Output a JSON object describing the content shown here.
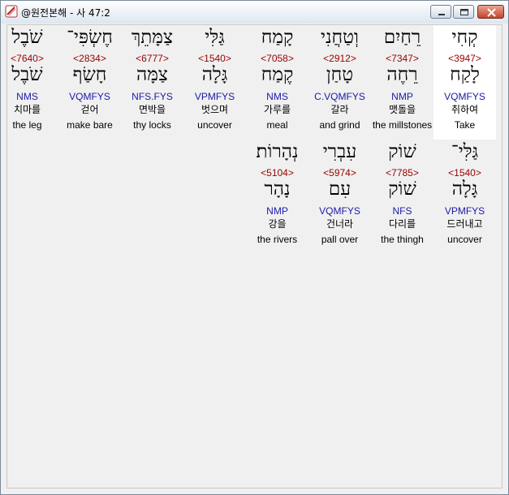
{
  "window": {
    "title": "@원전본해 - 사 47:2",
    "controls": [
      "minimize-icon",
      "maximize-icon",
      "close-icon"
    ]
  },
  "rows": [
    {
      "words": [
        {
          "heb": "קְחִי",
          "strong": "<3947>",
          "lemma": "לָקַח",
          "morph": "VQMFYS",
          "kor": "취하여",
          "eng": "Take",
          "highlighted": true
        },
        {
          "heb": "רֵחַיִם",
          "strong": "<7347>",
          "lemma": "רֵחֶה",
          "morph": "NMP",
          "kor": "맷돌을",
          "eng": "the millstones",
          "highlighted": false
        },
        {
          "heb": "וְטַחֲנִי",
          "strong": "<2912>",
          "lemma": "טָחַן",
          "morph": "C.VQMFYS",
          "kor": "갈라",
          "eng": "and grind",
          "highlighted": false
        },
        {
          "heb": "קָמַח",
          "strong": "<7058>",
          "lemma": "קֶמַח",
          "morph": "NMS",
          "kor": "가루를",
          "eng": "meal",
          "highlighted": false
        },
        {
          "heb": "גַּלִּי",
          "strong": "<1540>",
          "lemma": "גָּלָה",
          "morph": "VPMFYS",
          "kor": "벗으며",
          "eng": "uncover",
          "highlighted": false
        },
        {
          "heb": "צַמָּתֵךְ",
          "strong": "<6777>",
          "lemma": "צַמָּה",
          "morph": "NFS.FYS",
          "kor": "면박을",
          "eng": "thy locks",
          "highlighted": false
        },
        {
          "heb": "חֶשְׂפִּי־",
          "strong": "<2834>",
          "lemma": "חָשַׂף",
          "morph": "VQMFYS",
          "kor": "걷어",
          "eng": "make bare",
          "highlighted": false
        },
        {
          "heb": "שֹׁבֶל",
          "strong": "<7640>",
          "lemma": "שֹׁבֶל",
          "morph": "NMS",
          "kor": "치마를",
          "eng": "the leg",
          "highlighted": false
        }
      ]
    },
    {
      "words": [
        {
          "heb": "גַּלִּי־",
          "strong": "<1540>",
          "lemma": "גָּלָה",
          "morph": "VPMFYS",
          "kor": "드러내고",
          "eng": "uncover",
          "highlighted": false
        },
        {
          "heb": "שׁוֹק",
          "strong": "<7785>",
          "lemma": "שׁוֹק",
          "morph": "NFS",
          "kor": "다리를",
          "eng": "the thingh",
          "highlighted": false
        },
        {
          "heb": "עִבְרִי",
          "strong": "<5974>",
          "lemma": "עִם",
          "morph": "VQMFYS",
          "kor": "건너라",
          "eng": "pall over",
          "highlighted": false
        },
        {
          "heb": "נְהָרוֹת׃",
          "strong": "<5104>",
          "lemma": "נָהָר",
          "morph": "NMP",
          "kor": "강을",
          "eng": "the rivers",
          "highlighted": false
        }
      ]
    }
  ]
}
